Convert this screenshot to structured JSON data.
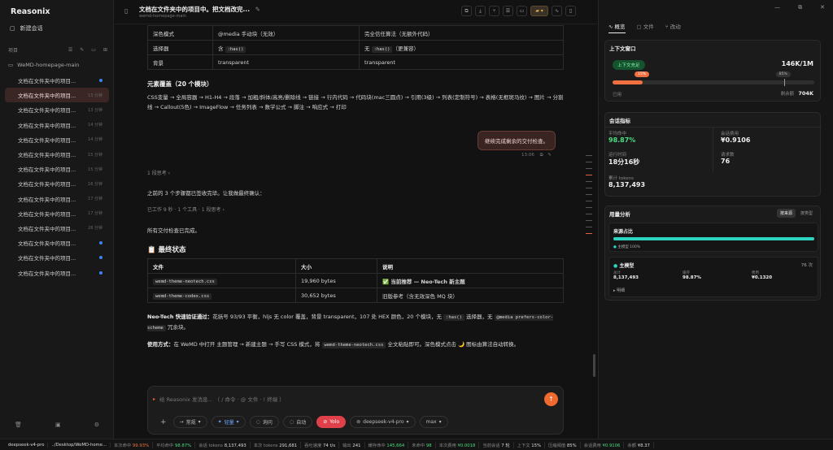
{
  "app": {
    "brand": "Reasonix"
  },
  "sidebar": {
    "new_chat": "新建会话",
    "projects_label": "项目",
    "folder": "WeMD-homepage-main",
    "sessions": [
      {
        "title": "文档在文件夹中的项目...",
        "time": "",
        "dot": true,
        "active": false
      },
      {
        "title": "文档在文件夹中的项目...",
        "time": "13 分钟",
        "dot": false,
        "active": true
      },
      {
        "title": "文档在文件夹中的项目...",
        "time": "13 分钟",
        "dot": false,
        "active": false
      },
      {
        "title": "文档在文件夹中的项目...",
        "time": "14 分钟",
        "dot": false,
        "active": false
      },
      {
        "title": "文档在文件夹中的项目...",
        "time": "14 分钟",
        "dot": false,
        "active": false
      },
      {
        "title": "文档在文件夹中的项目...",
        "time": "15 分钟",
        "dot": false,
        "active": false
      },
      {
        "title": "文档在文件夹中的项目...",
        "time": "15 分钟",
        "dot": false,
        "active": false
      },
      {
        "title": "文档在文件夹中的项目...",
        "time": "16 分钟",
        "dot": false,
        "active": false
      },
      {
        "title": "文档在文件夹中的项目...",
        "time": "17 分钟",
        "dot": false,
        "active": false
      },
      {
        "title": "文档在文件夹中的项目...",
        "time": "17 分钟",
        "dot": false,
        "active": false
      },
      {
        "title": "文档在文件夹中的项目...",
        "time": "28 分钟",
        "dot": false,
        "active": false
      },
      {
        "title": "文档在文件夹中的项目...",
        "time": "",
        "dot": true,
        "active": false
      },
      {
        "title": "文档在文件夹中的项目...",
        "time": "",
        "dot": true,
        "active": false
      },
      {
        "title": "文档在文件夹中的项目...",
        "time": "",
        "dot": true,
        "active": false
      }
    ]
  },
  "topbar": {
    "title": "文档在文件夹中的项目中。把文档改完...",
    "subtitle": "wemd-homepage-main"
  },
  "main": {
    "table1": [
      [
        "深色模式",
        "@media 手动块（无效）",
        "完全信任算法（无额外代码）"
      ],
      [
        "选择器",
        "含 :has()",
        "无 :has()（更兼容）"
      ],
      [
        "背景",
        "transparent",
        "transparent"
      ]
    ],
    "elements_heading": "元素覆盖（20 个模块）",
    "elements_text": "CSS变量 → 全局容器 → H1-H4 → 段落 → 加粗/斜体/高亮/删除线 → 链接 → 行内代码 → 代码块(mac三圆点) → 引用(3级) → 列表(定制符号) → 表格(无框斑马纹) → 图片 → 分割线 → Callout(5色) → ImageFlow → 任务列表 → 数学公式 → 脚注 → 响应式 → 打印",
    "user_msg": "继续完成剩余的交付检查。",
    "user_meta": "13:06",
    "thinking1": "1 段思考",
    "summary": "之前的 3 个步骤都已签收完毕。让我做最终确认：",
    "steps": "已工作 9 秒 · 1 个工具 · 1 段思考",
    "done": "所有交付检查已完成。",
    "final_heading": "📋 最终状态",
    "table2_head": [
      "文件",
      "大小",
      "说明"
    ],
    "table2": [
      [
        "wemd-theme-neotech.css",
        "19,960 bytes",
        "✅ 当前推荐 — Neo-Tech 新主题"
      ],
      [
        "wemd-theme-codex.css",
        "30,652 bytes",
        "旧版参考（含无效深色 MQ 块）"
      ]
    ],
    "neo_label": "Neo-Tech 快速验证通过：",
    "neo_text": "花括号 93/93 平衡，hljs 无 color 覆盖，背景 transparent，107 处 HEX 颜色，20 个模块，无 :has() 选择器，无 @media prefers-color-scheme 冗余块。",
    "usage_label": "使用方式：",
    "usage_text": "在 WeMD 中打开 主题管理 → 新建主题 → 手写 CSS 模式，将 wemd-theme-neotech.css 全文粘贴即可。深色模式点击 🌙 图标由算法自动转换。"
  },
  "input": {
    "placeholder": "给 Reasonix 发消息... （ / 命令 · @ 文件 · ! 终端 ）",
    "mode": "常规",
    "effort": "轻量",
    "ask": "询问",
    "auto": "自动",
    "yolo": "Yolo",
    "model": "deepseek-v4-pro",
    "max": "max"
  },
  "right": {
    "tabs": [
      "概览",
      "文件",
      "改动"
    ],
    "context": {
      "title": "上下文窗口",
      "badge": "上下文充足",
      "total": "146K/1M",
      "used_pct": 15,
      "used_pct_label": "15%",
      "mark_pct": 85,
      "mark_label": "85%",
      "used_label": "已用",
      "remain_label": "剩余额",
      "remain": "704K"
    },
    "metrics": {
      "title": "会话指标",
      "avg_hit_label": "平均命中",
      "avg_hit": "98.87%",
      "cost_label": "会话费用",
      "cost": "¥0.9106",
      "runtime_label": "运行时间",
      "runtime": "18分16秒",
      "requests_label": "请求数",
      "requests": "76",
      "tokens_label": "累计 tokens",
      "tokens": "8,137,493"
    },
    "usage": {
      "title": "用量分析",
      "tab_source": "按来源",
      "tab_type": "按类型",
      "source_title": "来源占比",
      "source_legend": "主模型 100%",
      "source_pct": 100,
      "main_model": "主模型",
      "main_count": "76 次",
      "total_label": "总计",
      "total": "8,137,493",
      "hit_label": "缓存",
      "hit": "98.87%",
      "fee_label": "费用",
      "fee": "¥0.1320",
      "detail": "明细"
    }
  },
  "status": [
    {
      "label": "",
      "value": "deepseek-v4-pro"
    },
    {
      "label": "",
      "value": "../Desktop/WeMD-home..."
    },
    {
      "label": "本次命中 ",
      "value": "99.93%"
    },
    {
      "label": "平均命中 ",
      "value": "98.87%"
    },
    {
      "label": "会话 tokens ",
      "value": "8,137,493"
    },
    {
      "label": "本次 tokens ",
      "value": "291,681"
    },
    {
      "label": "吞吐速度 ",
      "value": "74 t/s"
    },
    {
      "label": "输出 ",
      "value": "241"
    },
    {
      "label": "缓存命中 ",
      "value": "145,664"
    },
    {
      "label": "未命中 ",
      "value": "98"
    },
    {
      "label": "本次费用 ",
      "value": "¥0.0018"
    },
    {
      "label": "当前会话 ",
      "value": "7 轮"
    },
    {
      "label": "上下文 ",
      "value": "15%"
    },
    {
      "label": "压缩阈值 ",
      "value": "85%"
    },
    {
      "label": "会话费用 ",
      "value": "¥0.9106"
    },
    {
      "label": "余额 ",
      "value": "¥8.37"
    }
  ]
}
